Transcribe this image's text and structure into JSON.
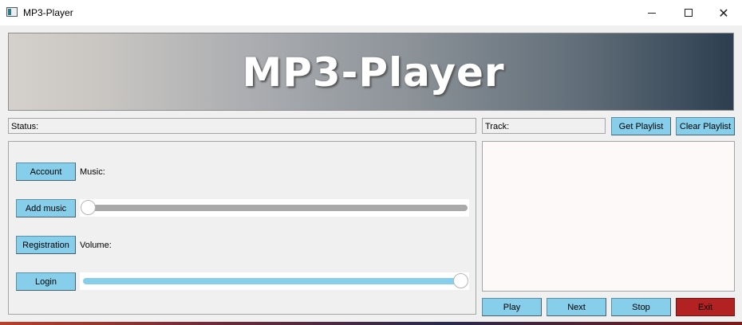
{
  "window": {
    "title": "MP3-Player",
    "controls": {
      "minimize": "minimize-icon",
      "maximize": "maximize-icon",
      "close": "close-icon"
    }
  },
  "banner": {
    "text": "MP3-Player"
  },
  "status": {
    "label": "Status:"
  },
  "track": {
    "label": "Track:"
  },
  "playlist_buttons": {
    "get": "Get Playlist",
    "clear": "Clear Playlist"
  },
  "left_buttons": {
    "account": "Account",
    "add_music": "Add music",
    "registration": "Registration",
    "login": "Login"
  },
  "labels": {
    "music": "Music:",
    "volume": "Volume:"
  },
  "sliders": {
    "music_position": 0.0,
    "volume_level": 1.0
  },
  "playback": {
    "play": "Play",
    "next": "Next",
    "stop": "Stop",
    "exit": "Exit"
  },
  "colors": {
    "button_accent": "#87ceeb",
    "exit_button": "#b22222",
    "music_groove": "#a9a9a9",
    "volume_groove": "#87ceeb",
    "banner_gradient_start": "#d4d0cb",
    "banner_gradient_end": "#2c3e4f"
  }
}
